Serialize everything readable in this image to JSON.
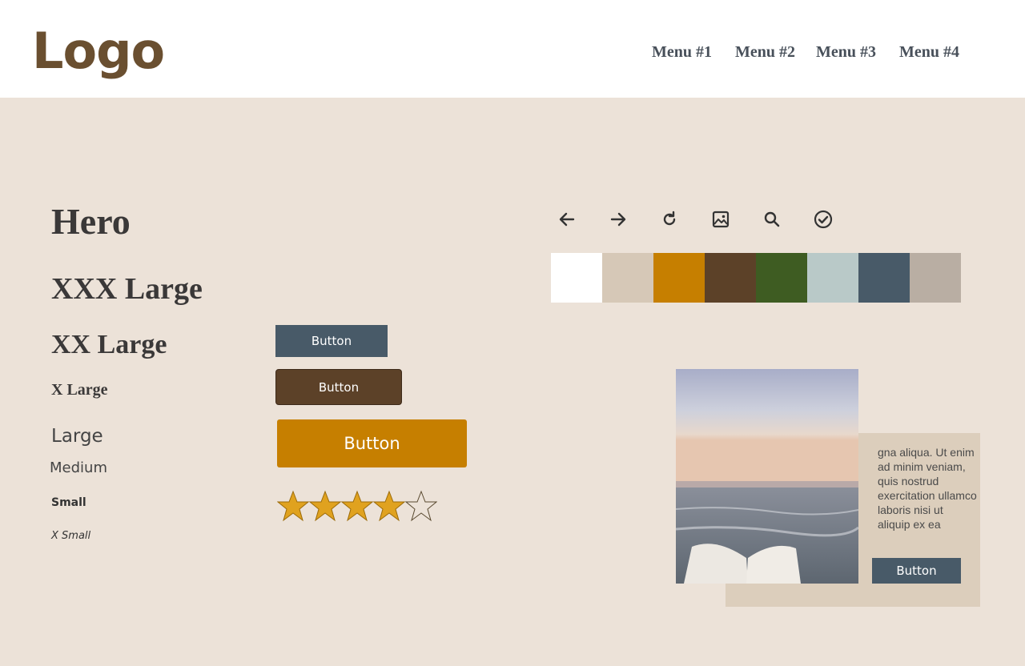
{
  "header": {
    "logo": "Logo",
    "menu": [
      "Menu #1",
      "Menu #2",
      "Menu #3",
      "Menu #4"
    ]
  },
  "typography": {
    "hero": "Hero",
    "xxx_large": "XXX Large",
    "xx_large": "XX Large",
    "x_large": "X Large",
    "large": "Large",
    "medium": "Medium",
    "small": "Small",
    "x_small": "X Small"
  },
  "buttons": {
    "primary_label": "Button",
    "secondary_label": "Button",
    "large_label": "Button"
  },
  "rating": {
    "value": 4,
    "max": 5
  },
  "icons": [
    "arrow-left-icon",
    "arrow-right-icon",
    "refresh-icon",
    "image-icon",
    "search-icon",
    "check-circle-icon"
  ],
  "palette": [
    "#ffffff",
    "#d6c8b7",
    "#c67f00",
    "#5c4128",
    "#3e5c22",
    "#b9c9c8",
    "#485a68",
    "#b9aea3"
  ],
  "card": {
    "text": "gna aliqua. Ut enim ad minim veniam, quis nostrud exercitation ullamco laboris nisi ut aliquip ex ea",
    "button_label": "Button"
  },
  "colors": {
    "background": "#ece2d8",
    "slate": "#485a68",
    "brown": "#5c4128",
    "gold": "#c67f00",
    "star": "#e0a21f"
  }
}
